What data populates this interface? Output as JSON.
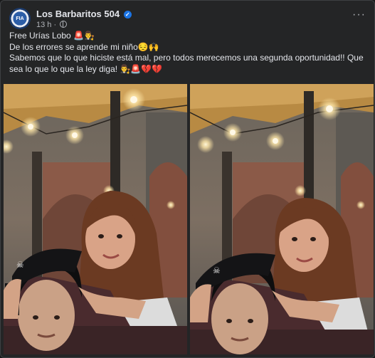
{
  "post": {
    "page_name": "Los Barbaritos 504",
    "avatar_text": "FIA",
    "timestamp": "13 h",
    "meta_separator": "·",
    "more_options": "···",
    "caption": {
      "line1": "Free Urías Lobo 🚨👨‍⚖️",
      "line2": "De los errores se aprende mi niño😔🙌",
      "line3": "Sabemos que lo que hiciste está mal, pero todos merecemos una segunda oportunidad!! Que sea lo que lo que la ley diga! 👨‍⚖️🚨💔💔"
    },
    "photos": [
      {
        "label": "photo-1"
      },
      {
        "label": "photo-2"
      }
    ]
  },
  "colors": {
    "background": "#18191a",
    "card": "#242526",
    "text_primary": "#e4e6eb",
    "text_secondary": "#b0b3b8",
    "verified_blue": "#1b74e4"
  }
}
